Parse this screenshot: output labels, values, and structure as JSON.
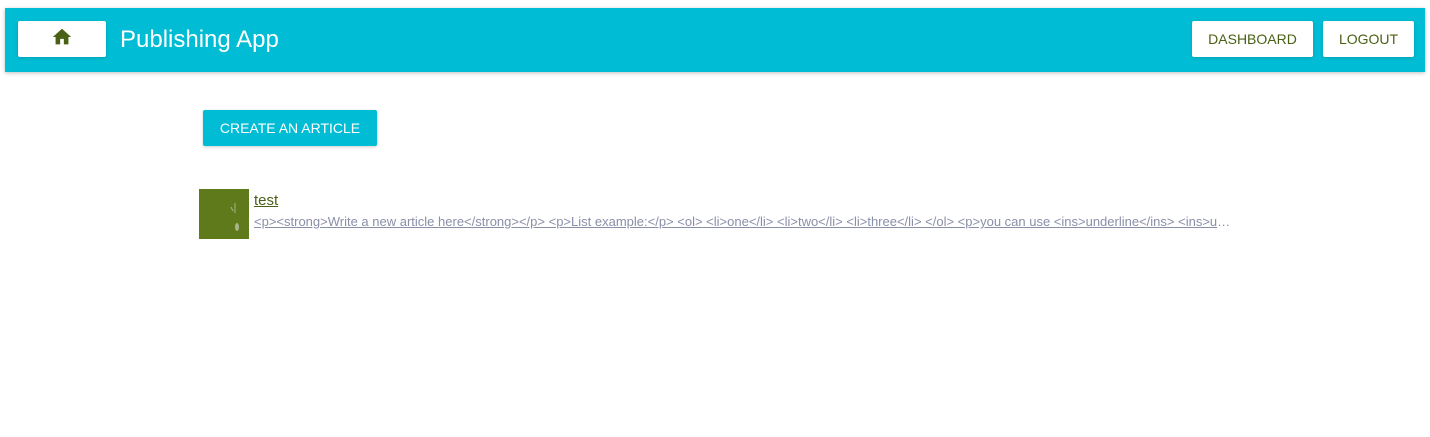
{
  "header": {
    "home_icon": "home-icon",
    "title": "Publishing App",
    "dashboard_label": "DASHBOARD",
    "logout_label": "LOGOUT",
    "bar_color": "#00bcd4"
  },
  "main": {
    "create_label": "CREATE AN ARTICLE",
    "articles": [
      {
        "title": "test",
        "preview": "<p><strong>Write a new article here</strong></p> <p>List example:</p> <ol> <li>one</li> <li>two</li> <li>three</li> </ol> <p>you can use <ins>underline</ins> <ins>underline</ins>",
        "thumbnail_color": "#5e7a1b"
      }
    ]
  }
}
